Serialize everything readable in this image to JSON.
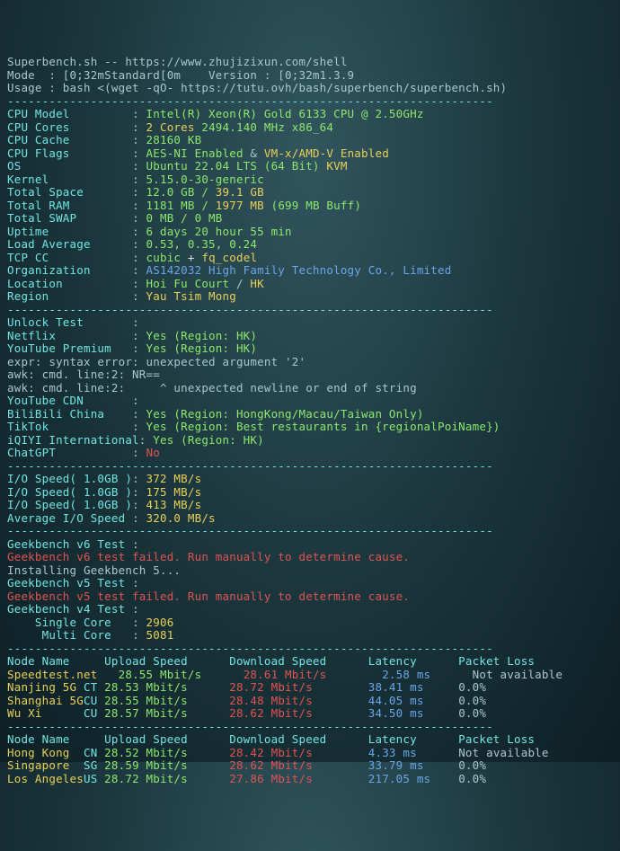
{
  "header": {
    "title_line": "Superbench.sh -- https://www.zhujizixun.com/shell",
    "mode_label": "Mode  : [0;32mStandard[0m    Version : [0;32m1.3.9",
    "usage": "Usage : bash <(wget -qO- https://tutu.ovh/bash/superbench/superbench.sh)"
  },
  "separator": "----------------------------------------------------------------------",
  "cpu": {
    "l_model": "CPU Model",
    "model": "Intel(R) Xeon(R) Gold 6133 CPU @ 2.50GHz",
    "l_cores": "CPU Cores",
    "cores_a": "2 Cores",
    "cores_b": "2494.140 MHz x86_64",
    "l_cache": "CPU Cache",
    "cache": "28160 KB",
    "l_flags": "CPU Flags",
    "flags_a": "AES-NI Enabled",
    "flags_b": "VM-x/AMD-V Enabled",
    "l_os": "OS",
    "os_a": "Ubuntu 22.04 LTS (64 Bit)",
    "os_b": "KVM",
    "l_kernel": "Kernel",
    "kernel": "5.15.0-30-generic",
    "l_space": "Total Space",
    "space_a": "12.0 GB /",
    "space_b": "39.1 GB",
    "l_ram": "Total RAM",
    "ram_a": "1181 MB /",
    "ram_b": "1977 MB",
    "ram_c": "(699 MB Buff)",
    "l_swap": "Total SWAP",
    "swap": "0 MB / 0 MB",
    "l_uptime": "Uptime",
    "uptime": "6 days 20 hour 55 min",
    "l_load": "Load Average",
    "load": "0.53, 0.35, 0.24",
    "l_tcc": "TCP CC",
    "tcc_a": "cubic",
    "tcc_p": "+",
    "tcc_b": "fq_codel",
    "l_org": "Organization",
    "org": "AS142032 High Family Technology Co., Limited",
    "l_loc": "Location",
    "loc_a": "Hoi Fu Court",
    "loc_b": "HK",
    "l_region": "Region",
    "region": "Yau Tsim Mong"
  },
  "unlock": {
    "title": "Unlock Test",
    "l_netflix": "Netflix",
    "netflix": "Yes (Region: HK)",
    "l_ytp": "YouTube Premium",
    "ytp": "Yes (Region: HK)",
    "err1": "expr: syntax error: unexpected argument '2'",
    "err2": "awk: cmd. line:2: NR==",
    "err3": "awk: cmd. line:2:     ^ unexpected newline or end of string",
    "l_ytcdn": "YouTube CDN",
    "ytcdn": "",
    "l_bili": "BiliBili China",
    "bili": "Yes (Region: HongKong/Macau/Taiwan Only)",
    "l_tiktok": "TikTok",
    "tiktok": "Yes (Region: Best restaurants in {regionalPoiName})",
    "l_iqiyi": "iQIYI International",
    "iqiyi": "Yes (Region: HK)",
    "l_chatgpt": "ChatGPT",
    "chatgpt": "No"
  },
  "io": {
    "l_r1": "I/O Speed( 1.0GB )",
    "r1": "372 MB/s",
    "l_r2": "I/O Speed( 1.0GB )",
    "r2": "175 MB/s",
    "l_r3": "I/O Speed( 1.0GB )",
    "r3": "413 MB/s",
    "l_avg": "Average I/O Speed",
    "avg": "320.0 MB/s"
  },
  "gb": {
    "l_v6": "Geekbench v6 Test",
    "fail6": "Geekbench v6 test failed. Run manually to determine cause.",
    "l_installing": "Installing Geekbench 5...",
    "l_v5": "Geekbench v5 Test",
    "fail5": "Geekbench v5 test failed. Run manually to determine cause.",
    "l_v4": "Geekbench v4 Test",
    "l_sc": "Single Core",
    "sc": "2906",
    "l_mc": "Multi Core",
    "mc": "5081"
  },
  "net_header": {
    "node": "Node Name",
    "up": "Upload Speed",
    "down": "Download Speed",
    "lat": "Latency",
    "loss": "Packet Loss"
  },
  "net1": [
    {
      "name": "Speedtest.net",
      "loc": "",
      "up": "28.55 Mbit/s",
      "down": "28.61 Mbit/s",
      "lat": "2.58 ms",
      "loss": "Not available"
    },
    {
      "name": "Nanjing 5G",
      "loc": "CT",
      "up": "28.53 Mbit/s",
      "down": "28.72 Mbit/s",
      "lat": "38.41 ms",
      "loss": "0.0%"
    },
    {
      "name": "Shanghai 5G",
      "loc": "CU",
      "up": "28.55 Mbit/s",
      "down": "28.48 Mbit/s",
      "lat": "44.05 ms",
      "loss": "0.0%"
    },
    {
      "name": "Wu Xi",
      "loc": "CU",
      "up": "28.57 Mbit/s",
      "down": "28.62 Mbit/s",
      "lat": "34.50 ms",
      "loss": "0.0%"
    }
  ],
  "net2": [
    {
      "name": "Hong Kong",
      "loc": "CN",
      "up": "28.52 Mbit/s",
      "down": "28.42 Mbit/s",
      "lat": "4.33 ms",
      "loss": "Not available"
    },
    {
      "name": "Singapore",
      "loc": "SG",
      "up": "28.59 Mbit/s",
      "down": "28.62 Mbit/s",
      "lat": "33.79 ms",
      "loss": "0.0%"
    },
    {
      "name": "Los Angeles",
      "loc": "US",
      "up": "28.72 Mbit/s",
      "down": "27.86 Mbit/s",
      "lat": "217.05 ms",
      "loss": "0.0%"
    }
  ]
}
